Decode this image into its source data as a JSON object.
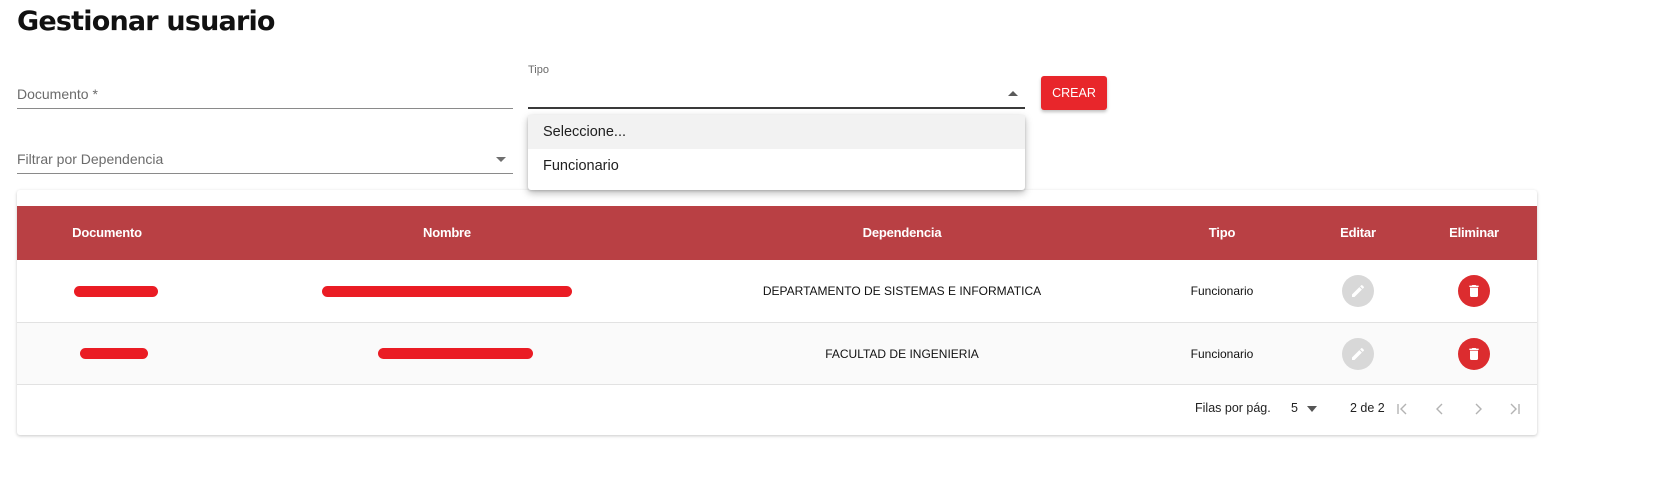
{
  "page": {
    "title": "Gestionar usuario"
  },
  "form": {
    "documento_placeholder": "Documento *",
    "tipo_label": "Tipo",
    "tipo_value": "",
    "crear_label": "CREAR",
    "filtro_placeholder": "Filtrar por Dependencia"
  },
  "dropdown": {
    "options": [
      "Seleccione...",
      "Funcionario"
    ],
    "highlighted_index": 0
  },
  "table": {
    "headers": {
      "documento": "Documento",
      "nombre": "Nombre",
      "dependencia": "Dependencia",
      "tipo": "Tipo",
      "editar": "Editar",
      "eliminar": "Eliminar"
    },
    "rows": [
      {
        "documento": "",
        "nombre": "",
        "dependencia": "DEPARTAMENTO DE SISTEMAS E INFORMATICA",
        "tipo": "Funcionario"
      },
      {
        "documento": "",
        "nombre": "",
        "dependencia": "FACULTAD DE INGENIERIA",
        "tipo": "Funcionario"
      }
    ],
    "redaction_note_color": "#ea1c24"
  },
  "pagination": {
    "rows_per_page_label": "Filas por pág.",
    "rows_per_page": "5",
    "page_info": "2 de 2"
  },
  "colors": {
    "header_bg": "#b94044",
    "primary_button": "#e8262b",
    "delete_button": "#dc2c2f",
    "edit_button_disabled": "#d8d8d8"
  },
  "icons": {
    "edit": "pencil-icon",
    "delete": "trash-icon",
    "first_page": "first-page-icon",
    "prev_page": "chevron-left-icon",
    "next_page": "chevron-right-icon",
    "last_page": "last-page-icon"
  }
}
